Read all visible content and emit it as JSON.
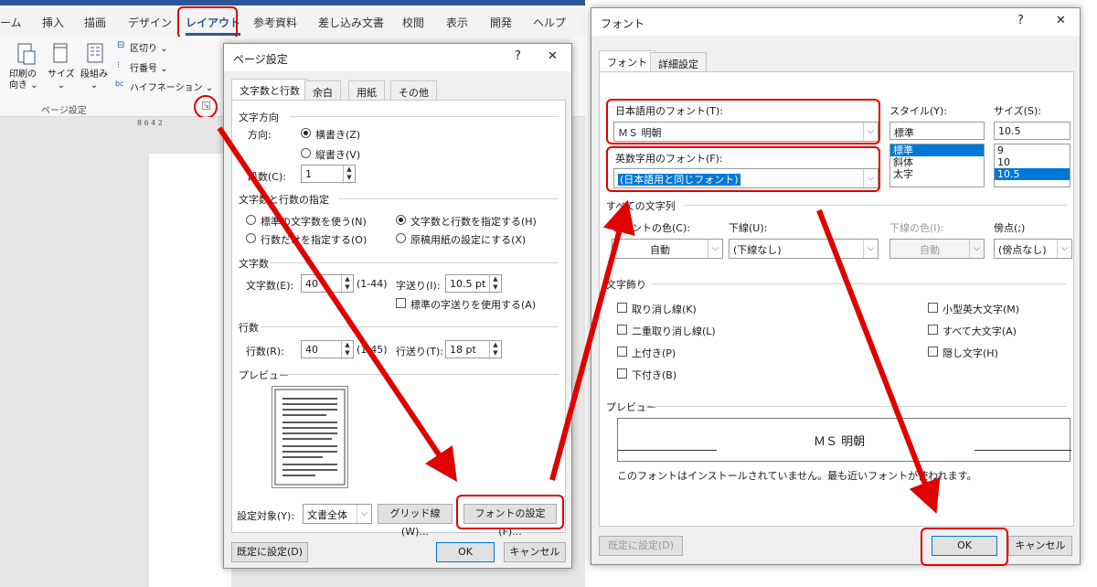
{
  "ribbon": {
    "tabs": [
      "ーム",
      "挿入",
      "描画",
      "デザイン",
      "レイアウト",
      "参考資料",
      "差し込み文書",
      "校閲",
      "表示",
      "開発",
      "ヘルプ"
    ],
    "buttons": {
      "orientation": "印刷の\n向き ⌄",
      "size": "サイズ\n⌄",
      "columns": "段組み\n⌄",
      "breaks": "区切り ⌄",
      "line_numbers": "行番号 ⌄",
      "hyphenation": "ハイフネーション ⌄"
    },
    "group_label": "ページ設定",
    "ruler": "8   6   4   2"
  },
  "page_setup": {
    "title": "ページ設定",
    "title_help": "?",
    "title_close": "✕",
    "tabs": [
      "文字数と行数",
      "余白",
      "用紙",
      "その他"
    ],
    "direction_section": "文字方向",
    "direction_label": "方向:",
    "horizontal": "横書き(Z)",
    "vertical": "縦書き(V)",
    "columns_label": "段数(C):",
    "columns_value": "1",
    "grid_section": "文字数と行数の指定",
    "opt_standard": "標準の文字数を使う(N)",
    "opt_chars_lines": "文字数と行数を指定する(H)",
    "opt_lines_only": "行数だけを指定する(O)",
    "opt_manuscript": "原稿用紙の設定にする(X)",
    "chars_section": "文字数",
    "chars_label": "文字数(E):",
    "chars_value": "40",
    "chars_range": "(1-44)",
    "char_pitch_label": "字送り(I):",
    "char_pitch_value": "10.5 pt",
    "use_standard_pitch": "標準の字送りを使用する(A)",
    "lines_section": "行数",
    "lines_label": "行数(R):",
    "lines_value": "40",
    "lines_range": "(1-45)",
    "line_pitch_label": "行送り(T):",
    "line_pitch_value": "18 pt",
    "preview_section": "プレビュー",
    "apply_to_label": "設定対象(Y):",
    "apply_to_value": "文書全体",
    "grid_button": "グリッド線(W)...",
    "font_button": "フォントの設定(F)...",
    "default_button": "既定に設定(D)",
    "ok_button": "OK",
    "cancel_button": "キャンセル"
  },
  "font_dialog": {
    "title": "フォント",
    "title_help": "?",
    "title_close": "✕",
    "tabs": [
      "フォント",
      "詳細設定"
    ],
    "jp_font_label": "日本語用のフォント(T):",
    "jp_font_value": "ＭＳ 明朝",
    "en_font_label": "英数字用のフォント(F):",
    "en_font_value": "(日本語用と同じフォント)",
    "style_label": "スタイル(Y):",
    "style_value": "標準",
    "style_options": [
      "標準",
      "斜体",
      "太字"
    ],
    "size_label": "サイズ(S):",
    "size_value": "10.5",
    "size_options": [
      "9",
      "10",
      "10.5"
    ],
    "all_text_section": "すべての文字列",
    "font_color_label": "フォントの色(C):",
    "font_color_value": "自動",
    "underline_label": "下線(U):",
    "underline_value": "(下線なし)",
    "underline_color_label": "下線の色(I):",
    "underline_color_value": "自動",
    "emphasis_label": "傍点(;)",
    "emphasis_value": "(傍点なし)",
    "effects_section": "文字飾り",
    "effects_left": [
      "取り消し線(K)",
      "二重取り消し線(L)",
      "上付き(P)",
      "下付き(B)"
    ],
    "effects_right": [
      "小型英大文字(M)",
      "すべて大文字(A)",
      "隠し文字(H)"
    ],
    "preview_section": "プレビュー",
    "preview_text": "ＭＳ 明朝",
    "preview_note": "このフォントはインストールされていません。最も近いフォントが使われます。",
    "default_button": "既定に設定(D)",
    "ok_button": "OK",
    "cancel_button": "キャンセル"
  },
  "colors": {
    "annotation_red": "#e00000",
    "word_blue": "#2b579a",
    "selection_blue": "#0078d7"
  }
}
